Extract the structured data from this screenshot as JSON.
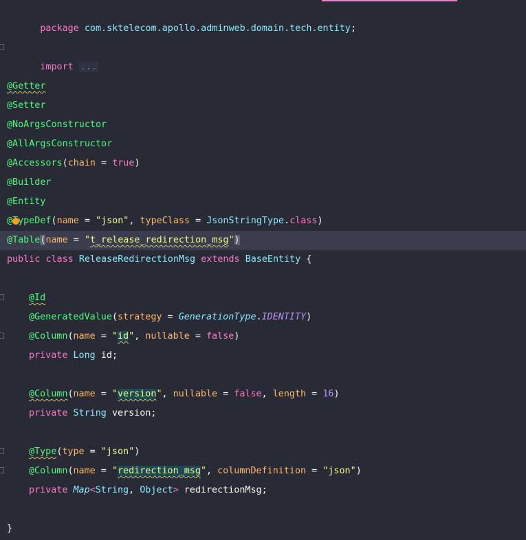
{
  "editor": {
    "language": "java",
    "colors": {
      "background": "#282a36",
      "current_line": "#3a3d4e",
      "keyword": "#ff79c6",
      "annotation": "#50fa7b",
      "string": "#f1fa8c",
      "parameter": "#ffb86c",
      "class_name": "#8be9fd",
      "number": "#bd93f9"
    },
    "package": {
      "keyword": "package",
      "name": "com.sktelecom.apollo.adminweb.domain.tech.entity",
      "semicolon": ";"
    },
    "imports": {
      "keyword": "import",
      "collapsed": "..."
    },
    "class_annotations": {
      "getter": "@Getter",
      "setter": "@Setter",
      "no_args": "@NoArgsConstructor",
      "all_args": "@AllArgsConstructor",
      "accessors": "@Accessors",
      "accessors_param": "chain",
      "accessors_value": "true",
      "builder": "@Builder",
      "entity": "@Entity",
      "typedef_at": "@",
      "typedef_name": "TypeDef",
      "typedef_param1": "name",
      "typedef_value1": "\"json\"",
      "typedef_param2": "typeClass",
      "typedef_class": "JsonStringType",
      "typedef_class_kw": "class",
      "table": "@Table",
      "table_param": "name",
      "table_value_prefix": "\"",
      "table_value": "t_release_redirection_msg",
      "table_value_suffix": "\""
    },
    "class_decl": {
      "public": "public",
      "class": "class",
      "name": "ReleaseRedirectionMsg",
      "extends": "extends",
      "parent": "BaseEntity",
      "open_brace": "{",
      "close_brace": "}"
    },
    "field_id": {
      "ann_id": "@Id",
      "ann_generated": "@GeneratedValue",
      "generated_param": "strategy",
      "generated_type": "GenerationType",
      "generated_const": "IDENTITY",
      "ann_column": "@Column",
      "column_param1": "name",
      "column_value1": "id",
      "column_param2": "nullable",
      "column_value2": "false",
      "modifier": "private",
      "type": "Long",
      "name": "id"
    },
    "field_version": {
      "ann_column": "@Column",
      "column_param1": "name",
      "column_value1": "version",
      "column_param2": "nullable",
      "column_value2": "false",
      "column_param3": "length",
      "column_value3": "16",
      "modifier": "private",
      "type": "String",
      "name": "version"
    },
    "field_redirection": {
      "ann_type": "@Type",
      "type_param": "type",
      "type_value": "\"json\"",
      "ann_column": "@Column",
      "column_param1": "name",
      "column_value1": "redirection_msg",
      "column_param2": "columnDefinition",
      "column_value2": "\"json\"",
      "modifier": "private",
      "map_type": "Map",
      "generic_type1": "String",
      "generic_type2": "Object",
      "name": "redirectionMsg"
    }
  }
}
